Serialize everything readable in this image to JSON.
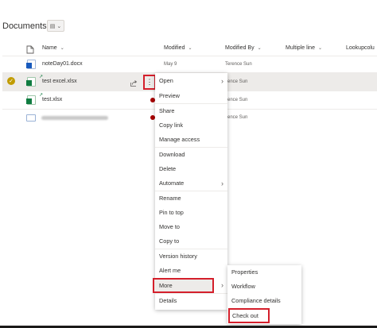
{
  "page": {
    "title": "Documents"
  },
  "columns": {
    "name": "Name",
    "modified": "Modified",
    "modified_by": "Modified By",
    "multiple_line": "Multiple line",
    "lookup": "Lookupcolu"
  },
  "rows": [
    {
      "name": "noteDay01.docx",
      "modified": "May 9",
      "modified_by": "Terence Sun",
      "type": "word"
    },
    {
      "name": "test excel.xlsx",
      "modified": "",
      "modified_by": "rence Sun",
      "type": "excel",
      "selected": true
    },
    {
      "name": "test.xlsx",
      "modified": "",
      "modified_by": "rence Sun",
      "type": "excel"
    },
    {
      "name": "",
      "modified": "",
      "modified_by": "rence Sun",
      "type": "generic",
      "redacted": true
    }
  ],
  "context_menu": {
    "items": [
      "Open",
      "Preview",
      "Share",
      "Copy link",
      "Manage access",
      "Download",
      "Delete",
      "Automate",
      "Rename",
      "Pin to top",
      "Move to",
      "Copy to",
      "Version history",
      "Alert me",
      "More",
      "Details"
    ]
  },
  "submenu": {
    "items": [
      "Properties",
      "Workflow",
      "Compliance details",
      "Check out"
    ]
  },
  "icons": {
    "more_actions": "vertical-ellipsis-icon",
    "share": "share-icon",
    "view_switcher": "library-icon",
    "checkmark": "checkmark-icon"
  },
  "colors": {
    "highlight": "#d41f2b",
    "selection": "#edebe9",
    "checkmark": "#c19c00"
  }
}
